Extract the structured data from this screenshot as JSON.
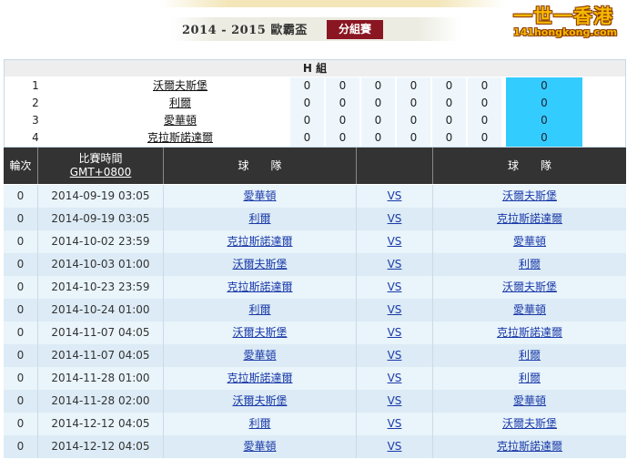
{
  "header": {
    "season_title": "2014 - 2015 歐霸盃",
    "stage_tab": "分組賽",
    "logo_main": "一世一香港",
    "logo_url": "141hongkong.com"
  },
  "group": {
    "title": "H 組",
    "standings": [
      {
        "rank": "1",
        "team": "沃爾夫斯堡",
        "stats": [
          "0",
          "0",
          "0",
          "0",
          "0",
          "0"
        ],
        "points": "0"
      },
      {
        "rank": "2",
        "team": "利爾",
        "stats": [
          "0",
          "0",
          "0",
          "0",
          "0",
          "0"
        ],
        "points": "0"
      },
      {
        "rank": "3",
        "team": "愛華頓",
        "stats": [
          "0",
          "0",
          "0",
          "0",
          "0",
          "0"
        ],
        "points": "0"
      },
      {
        "rank": "4",
        "team": "克拉斯諾達爾",
        "stats": [
          "0",
          "0",
          "0",
          "0",
          "0",
          "0"
        ],
        "points": "0"
      }
    ]
  },
  "matches_header": {
    "round": "輪次",
    "time_line1": "比賽時間",
    "time_line2": "GMT+0800",
    "home": "球　　隊",
    "vs": "",
    "away": "球　　隊"
  },
  "matches": [
    {
      "round": "0",
      "time": "2014-09-19 03:05",
      "home": "愛華頓",
      "vs": "VS",
      "away": "沃爾夫斯堡"
    },
    {
      "round": "0",
      "time": "2014-09-19 03:05",
      "home": "利爾",
      "vs": "VS",
      "away": "克拉斯諾達爾"
    },
    {
      "round": "0",
      "time": "2014-10-02 23:59",
      "home": "克拉斯諾達爾",
      "vs": "VS",
      "away": "愛華頓"
    },
    {
      "round": "0",
      "time": "2014-10-03 01:00",
      "home": "沃爾夫斯堡",
      "vs": "VS",
      "away": "利爾"
    },
    {
      "round": "0",
      "time": "2014-10-23 23:59",
      "home": "克拉斯諾達爾",
      "vs": "VS",
      "away": "沃爾夫斯堡"
    },
    {
      "round": "0",
      "time": "2014-10-24 01:00",
      "home": "利爾",
      "vs": "VS",
      "away": "愛華頓"
    },
    {
      "round": "0",
      "time": "2014-11-07 04:05",
      "home": "沃爾夫斯堡",
      "vs": "VS",
      "away": "克拉斯諾達爾"
    },
    {
      "round": "0",
      "time": "2014-11-07 04:05",
      "home": "愛華頓",
      "vs": "VS",
      "away": "利爾"
    },
    {
      "round": "0",
      "time": "2014-11-28 01:00",
      "home": "克拉斯諾達爾",
      "vs": "VS",
      "away": "利爾"
    },
    {
      "round": "0",
      "time": "2014-11-28 02:00",
      "home": "沃爾夫斯堡",
      "vs": "VS",
      "away": "愛華頓"
    },
    {
      "round": "0",
      "time": "2014-12-12 04:05",
      "home": "利爾",
      "vs": "VS",
      "away": "沃爾夫斯堡"
    },
    {
      "round": "0",
      "time": "2014-12-12 04:05",
      "home": "愛華頓",
      "vs": "VS",
      "away": "克拉斯諾達爾"
    }
  ],
  "colors": {
    "stage_tab_bg": "#8a1622",
    "points_bg": "#33ccff",
    "header_bg": "#333333",
    "link": "#1a3aa8"
  }
}
